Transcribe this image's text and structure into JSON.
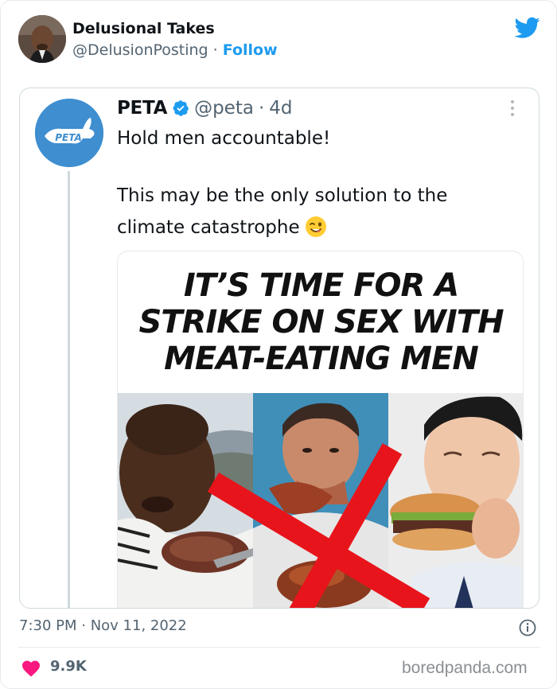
{
  "author": {
    "name": "Delusional Takes",
    "handle": "@DelusionPosting",
    "separator": "·",
    "follow_label": "Follow"
  },
  "quoted_tweet": {
    "name": "PETA",
    "handle": "@peta",
    "separator": "·",
    "age": "4d",
    "avatar_logo_text": "PETA",
    "line1": "Hold men accountable!",
    "line2": "This may be the only solution to the",
    "line3": "climate catastrophe",
    "emoji": "winking-face-with-tongue",
    "media": {
      "headline": [
        "IT’S TIME FOR A",
        "STRIKE ON SEX WITH",
        "MEAT-EATING MEN"
      ]
    }
  },
  "footer": {
    "timestamp": "7:30 PM · Nov 11, 2022",
    "likes": "9.9K",
    "watermark": "boredpanda.com"
  },
  "colors": {
    "twitter_blue": "#1d9bf0",
    "peta_blue": "#3e8ed0",
    "heart": "#f91880",
    "cross_red": "#e8141b",
    "secondary_text": "#536471"
  }
}
